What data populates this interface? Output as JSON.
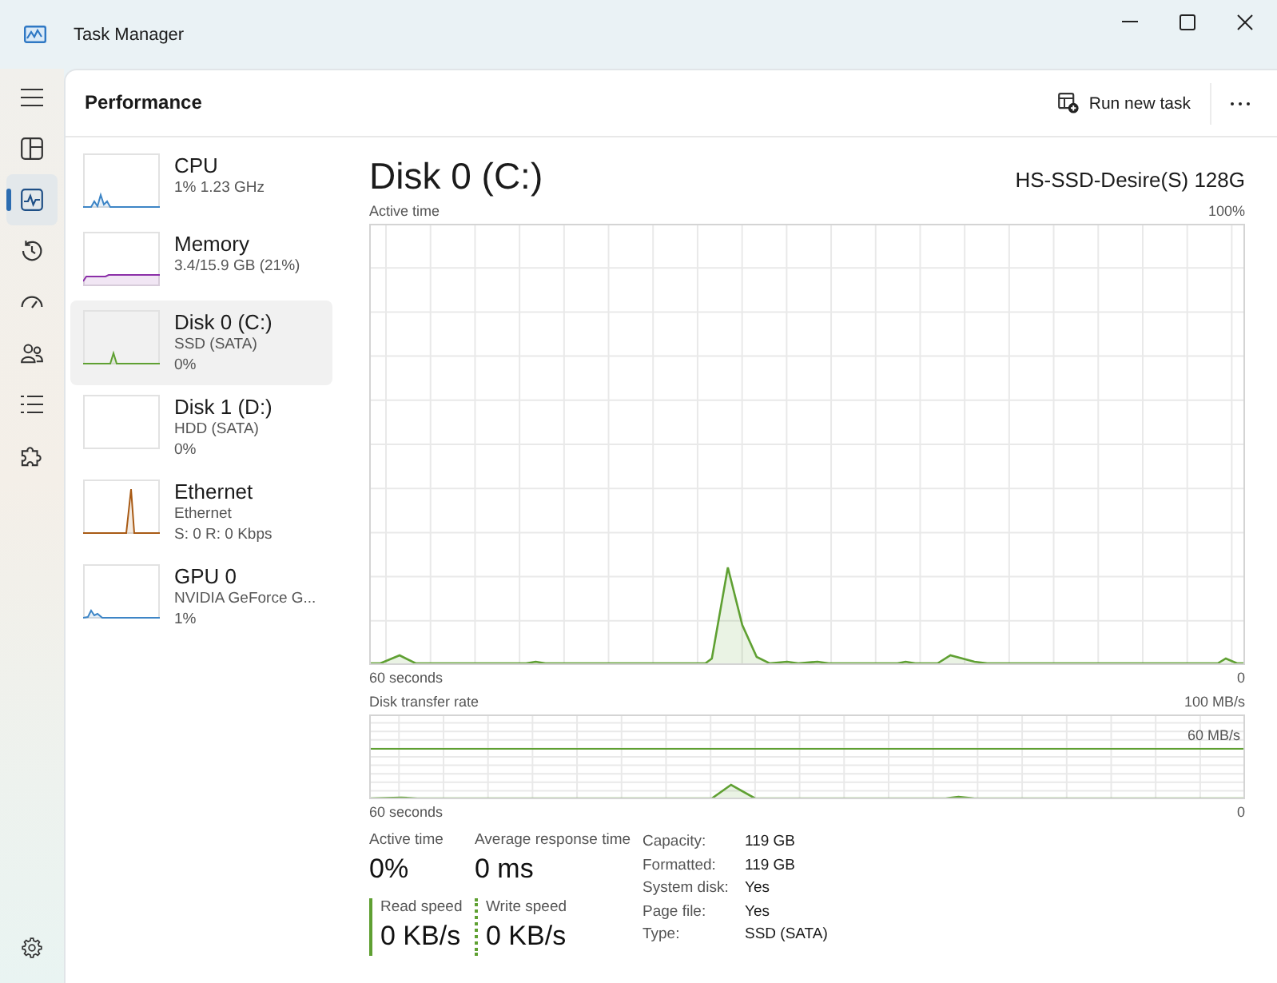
{
  "window": {
    "title": "Task Manager"
  },
  "nav": {
    "items": [
      {
        "kind": "processes",
        "selected": false
      },
      {
        "kind": "performance",
        "selected": true
      },
      {
        "kind": "history",
        "selected": false
      },
      {
        "kind": "startup",
        "selected": false
      },
      {
        "kind": "users",
        "selected": false
      },
      {
        "kind": "details",
        "selected": false
      },
      {
        "kind": "services",
        "selected": false
      }
    ]
  },
  "header": {
    "title": "Performance",
    "run_task": "Run new task"
  },
  "resources": [
    {
      "name": "CPU",
      "details": [
        "1% 1.23 GHz"
      ],
      "color": "#3d85c6",
      "selected": false
    },
    {
      "name": "Memory",
      "details": [
        "3.4/15.9 GB (21%)"
      ],
      "color": "#8b2fa8",
      "selected": false
    },
    {
      "name": "Disk 0 (C:)",
      "details": [
        "SSD (SATA)",
        "0%"
      ],
      "color": "#5fa032",
      "selected": true
    },
    {
      "name": "Disk 1 (D:)",
      "details": [
        "HDD (SATA)",
        "0%"
      ],
      "selected": false
    },
    {
      "name": "Ethernet",
      "details": [
        "Ethernet",
        "S: 0 R: 0 Kbps"
      ],
      "color": "#a85a14",
      "selected": false
    },
    {
      "name": "GPU 0",
      "details": [
        "NVIDIA GeForce G...",
        "1%"
      ],
      "color": "#3d85c6",
      "selected": false
    }
  ],
  "detail": {
    "title": "Disk 0 (C:)",
    "model": "HS-SSD-Desire(S) 128G",
    "active_time": {
      "label": "Active time",
      "max": "100%",
      "start": "60 seconds",
      "end": "0"
    },
    "transfer_rate": {
      "label": "Disk transfer rate",
      "max": "100 MB/s",
      "scale": "60 MB/s",
      "start": "60 seconds",
      "end": "0"
    },
    "stats": [
      {
        "kind": "plain",
        "label": "Active time",
        "value": "0%"
      },
      {
        "kind": "plain",
        "label": "Average response time",
        "value": "0 ms"
      },
      {
        "kind": "read",
        "label": "Read speed",
        "value": "0 KB/s"
      },
      {
        "kind": "write",
        "label": "Write speed",
        "value": "0 KB/s"
      }
    ],
    "properties": [
      {
        "label": "Capacity:",
        "value": "119 GB"
      },
      {
        "label": "Formatted:",
        "value": "119 GB"
      },
      {
        "label": "System disk:",
        "value": "Yes"
      },
      {
        "label": "Page file:",
        "value": "Yes"
      },
      {
        "label": "Type:",
        "value": "SSD (SATA)"
      }
    ]
  }
}
